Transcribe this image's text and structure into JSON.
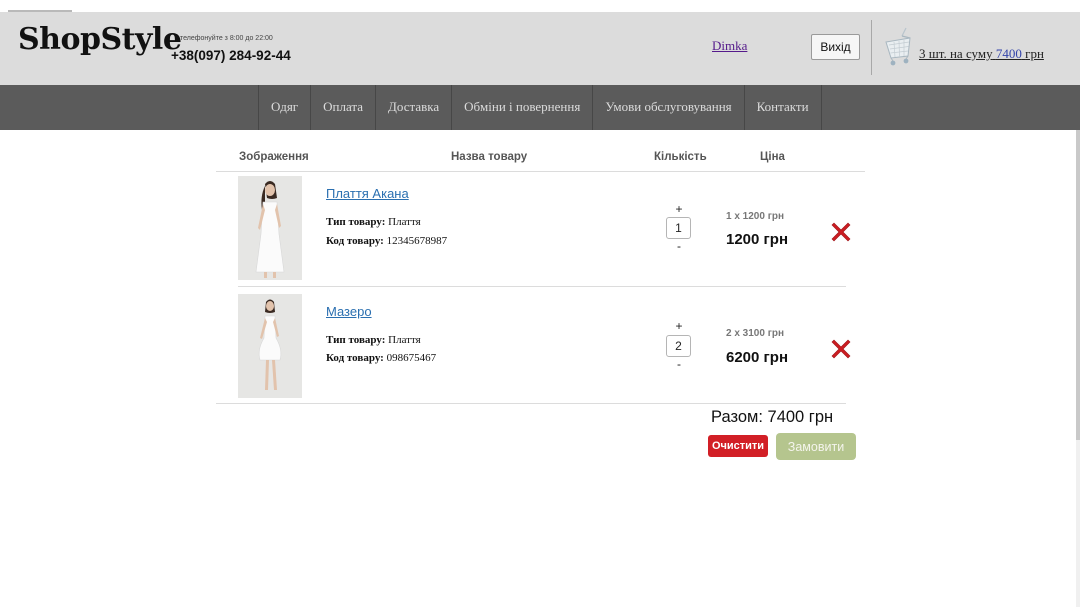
{
  "header": {
    "logo": "ShopStyle",
    "hours": "телефонуйте з 8:00 до 22:00",
    "phone": "+38(097) 284-92-44",
    "user": "Dimka",
    "logout_label": "Вихід",
    "cart": {
      "count": "3 шт.",
      "sum_prefix": "на суму",
      "sum_value": "7400",
      "currency": "грн"
    }
  },
  "nav": {
    "items": [
      "Одяг",
      "Оплата",
      "Доставка",
      "Обміни і повернення",
      "Умови обслуговування",
      "Контакти"
    ]
  },
  "table": {
    "headers": {
      "image": "Зображення",
      "name": "Назва товару",
      "quantity": "Кількість",
      "price": "Ціна"
    },
    "type_label": "Тип товару:",
    "code_label": "Код товару:",
    "rows": [
      {
        "name": "Плаття Акана",
        "type": "Плаття",
        "code": "12345678987",
        "plus": "+",
        "qty": "1",
        "minus": "-",
        "unit_price": "1 x 1200 грн",
        "total": "1200 грн"
      },
      {
        "name": "Мазеро",
        "type": "Плаття",
        "code": "098675467",
        "plus": "+",
        "qty": "2",
        "minus": "-",
        "unit_price": "2 x 3100 грн",
        "total": "6200 грн"
      }
    ]
  },
  "summary": {
    "total": "Разом: 7400 грн",
    "clear_label": "Очистити",
    "order_label": "Замовити"
  },
  "colors": {
    "header_bg": "#dcdcdc",
    "nav_bg": "#5b5b5b",
    "link": "#2a6fb0",
    "delete": "#cc1d22",
    "clear_button": "#d21f26",
    "order_button": "#b5c58e"
  },
  "icons": {
    "cart": "shopping-cart-icon",
    "delete": "delete-x-icon"
  }
}
